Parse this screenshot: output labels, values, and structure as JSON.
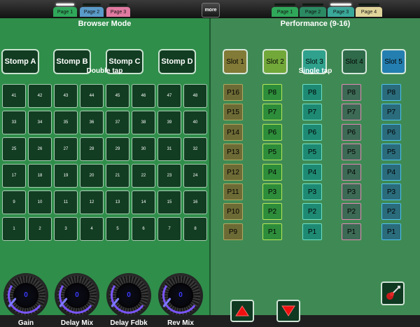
{
  "top_bar": {
    "left_tabs": [
      "Page 1",
      "Page 2",
      "Page 3"
    ],
    "more_label": "more",
    "right_tabs": [
      "Page 1",
      "Page 2",
      "Page 3",
      "Page 4"
    ]
  },
  "colors": {
    "left_panel": "#2f8e4a",
    "right_panel": "#3f8a54",
    "left_tab_colors": [
      "#2fa85a",
      "#5a9ac8",
      "#e07aa0"
    ],
    "right_tab_colors": [
      "#2fa85a",
      "#2b8a62",
      "#3aa899",
      "#e0d49a"
    ],
    "slot_colors": [
      "#827a37",
      "#72a83a",
      "#2fa18c",
      "#2f6a4b",
      "#247fb0"
    ],
    "column_colors": [
      {
        "bg": "#6d6b35",
        "border": "#b2a860"
      },
      {
        "bg": "#2d8d3a",
        "border": "#b8e85c"
      },
      {
        "bg": "#1e8a73",
        "border": "#6fe0c7"
      },
      {
        "bg": "#3d6a55",
        "border": "#e38bb5"
      },
      {
        "bg": "#2a6c7c",
        "border": "#4fc1f1"
      }
    ]
  },
  "browser": {
    "title": "Browser Mode",
    "stomps": [
      "Stomp A",
      "Stomp B",
      "Stomp C",
      "Stomp D"
    ],
    "double_tap_label": "Double tap",
    "grid_rows": [
      [
        "41",
        "42",
        "43",
        "44",
        "45",
        "46",
        "47",
        "48"
      ],
      [
        "33",
        "34",
        "35",
        "36",
        "37",
        "38",
        "39",
        "40"
      ],
      [
        "25",
        "26",
        "27",
        "28",
        "29",
        "30",
        "31",
        "32"
      ],
      [
        "17",
        "18",
        "19",
        "20",
        "21",
        "22",
        "23",
        "24"
      ],
      [
        "9",
        "10",
        "11",
        "12",
        "13",
        "14",
        "15",
        "16"
      ],
      [
        "1",
        "2",
        "3",
        "4",
        "5",
        "6",
        "7",
        "8"
      ]
    ],
    "knobs": [
      {
        "label": "Gain",
        "value": "0"
      },
      {
        "label": "Delay Mix",
        "value": "0"
      },
      {
        "label": "Delay Fdbk",
        "value": "0"
      },
      {
        "label": "Rev Mix",
        "value": "0"
      }
    ]
  },
  "performance": {
    "title": "Performance (9-16)",
    "slots": [
      "Slot 1",
      "Slot 2",
      "Slot 3",
      "Slot 4",
      "Slot 5"
    ],
    "single_tap_label": "Single tap",
    "columns": [
      [
        "P16",
        "P15",
        "P14",
        "P13",
        "P12",
        "P11",
        "P10",
        "P9"
      ],
      [
        "P8",
        "P7",
        "P6",
        "P5",
        "P4",
        "P3",
        "P2",
        "P1"
      ],
      [
        "P8",
        "P7",
        "P6",
        "P5",
        "P4",
        "P3",
        "P2",
        "P1"
      ],
      [
        "P8",
        "P7",
        "P6",
        "P5",
        "P4",
        "P3",
        "P2",
        "P1"
      ],
      [
        "P8",
        "P7",
        "P6",
        "P5",
        "P4",
        "P3",
        "P2",
        "P1"
      ]
    ],
    "icons": {
      "up": "arrow-up-icon",
      "down": "arrow-down-icon",
      "guitar": "guitar-icon"
    }
  }
}
